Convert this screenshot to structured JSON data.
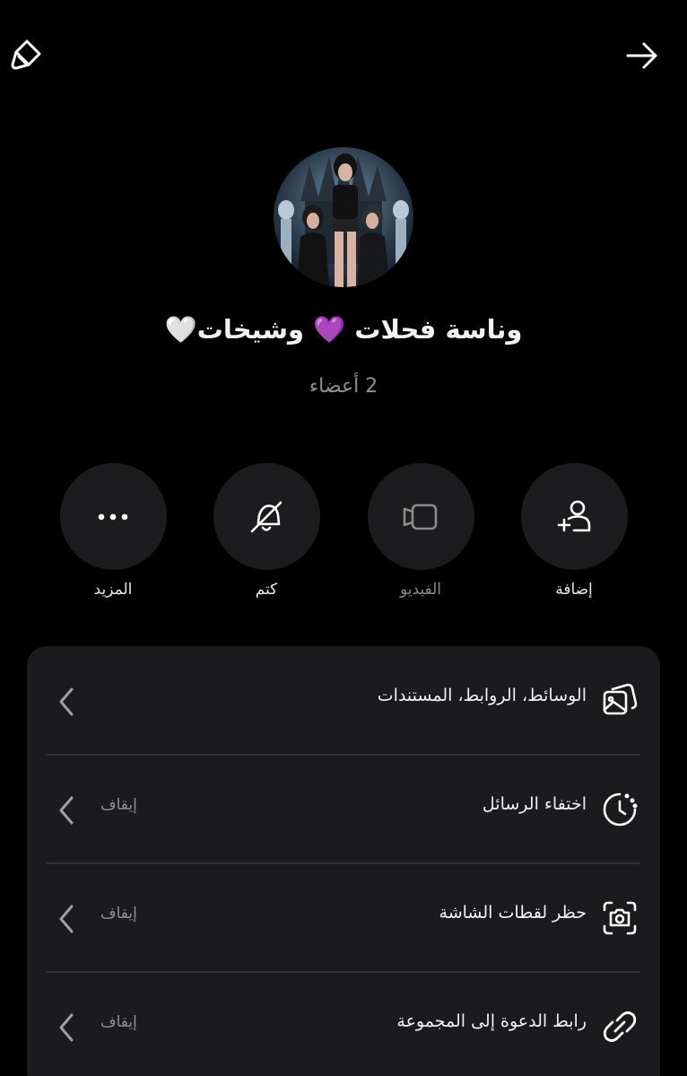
{
  "header": {
    "edit_icon": "pencil-icon",
    "back_icon": "arrow-right-icon"
  },
  "group": {
    "name": "وناسة فحلات 💜 وشيخات🤍",
    "members": "2 أعضاء"
  },
  "actions": [
    {
      "label": "إضافة",
      "icon": "add-user-icon",
      "enabled": true
    },
    {
      "label": "الفيديو",
      "icon": "video-icon",
      "enabled": false
    },
    {
      "label": "كتم",
      "icon": "bell-off-icon",
      "enabled": true
    },
    {
      "label": "المزيد",
      "icon": "more-dots-icon",
      "enabled": true
    }
  ],
  "settings": [
    {
      "label": "الوسائط، الروابط، المستندات",
      "value": "",
      "icon": "media-icon"
    },
    {
      "label": "اختفاء الرسائل",
      "value": "إيقاف",
      "icon": "timer-icon"
    },
    {
      "label": "حظر لقطات الشاشة",
      "value": "إيقاف",
      "icon": "screenshot-camera-icon"
    },
    {
      "label": "رابط الدعوة إلى المجموعة",
      "value": "إيقاف",
      "icon": "link-icon"
    }
  ],
  "colors": {
    "background": "#000000",
    "surface": "#1b1b1d",
    "button": "#1c1c1e",
    "text_secondary": "#8f8f8f"
  }
}
